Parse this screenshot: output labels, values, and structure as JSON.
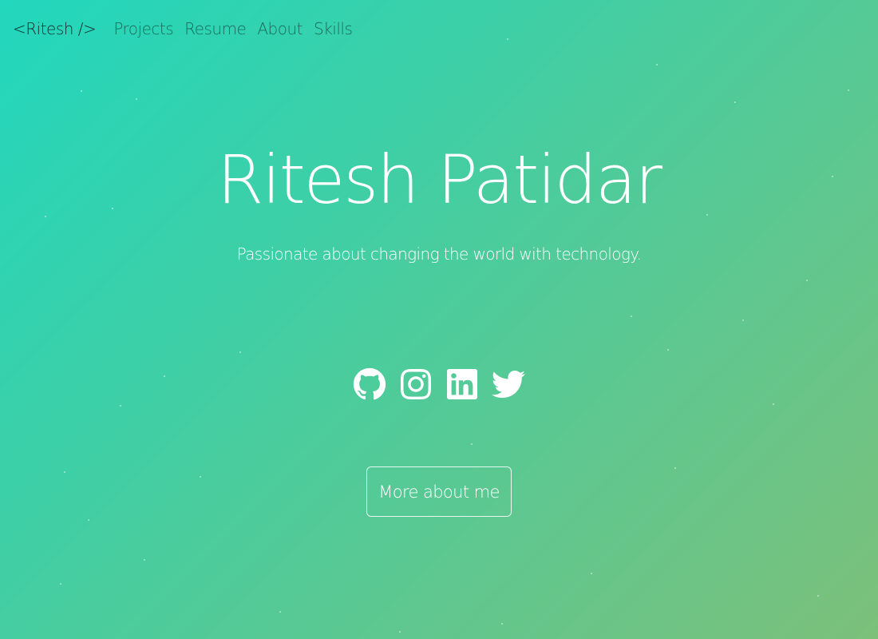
{
  "nav": {
    "brand": "<Ritesh />",
    "links": [
      {
        "label": "Projects"
      },
      {
        "label": "Resume"
      },
      {
        "label": "About"
      },
      {
        "label": "Skills"
      }
    ]
  },
  "hero": {
    "name": "Ritesh Patidar",
    "tagline": "Passionate about changing the world with technology."
  },
  "social": [
    {
      "icon": "github-icon"
    },
    {
      "icon": "instagram-icon"
    },
    {
      "icon": "linkedin-icon"
    },
    {
      "icon": "twitter-icon"
    }
  ],
  "cta": {
    "label": "More about me"
  },
  "colors": {
    "gradient_start": "#22d7bd",
    "gradient_end": "#7cc07a",
    "text": "#ffffff",
    "brand_text": "#0f2e2a"
  }
}
